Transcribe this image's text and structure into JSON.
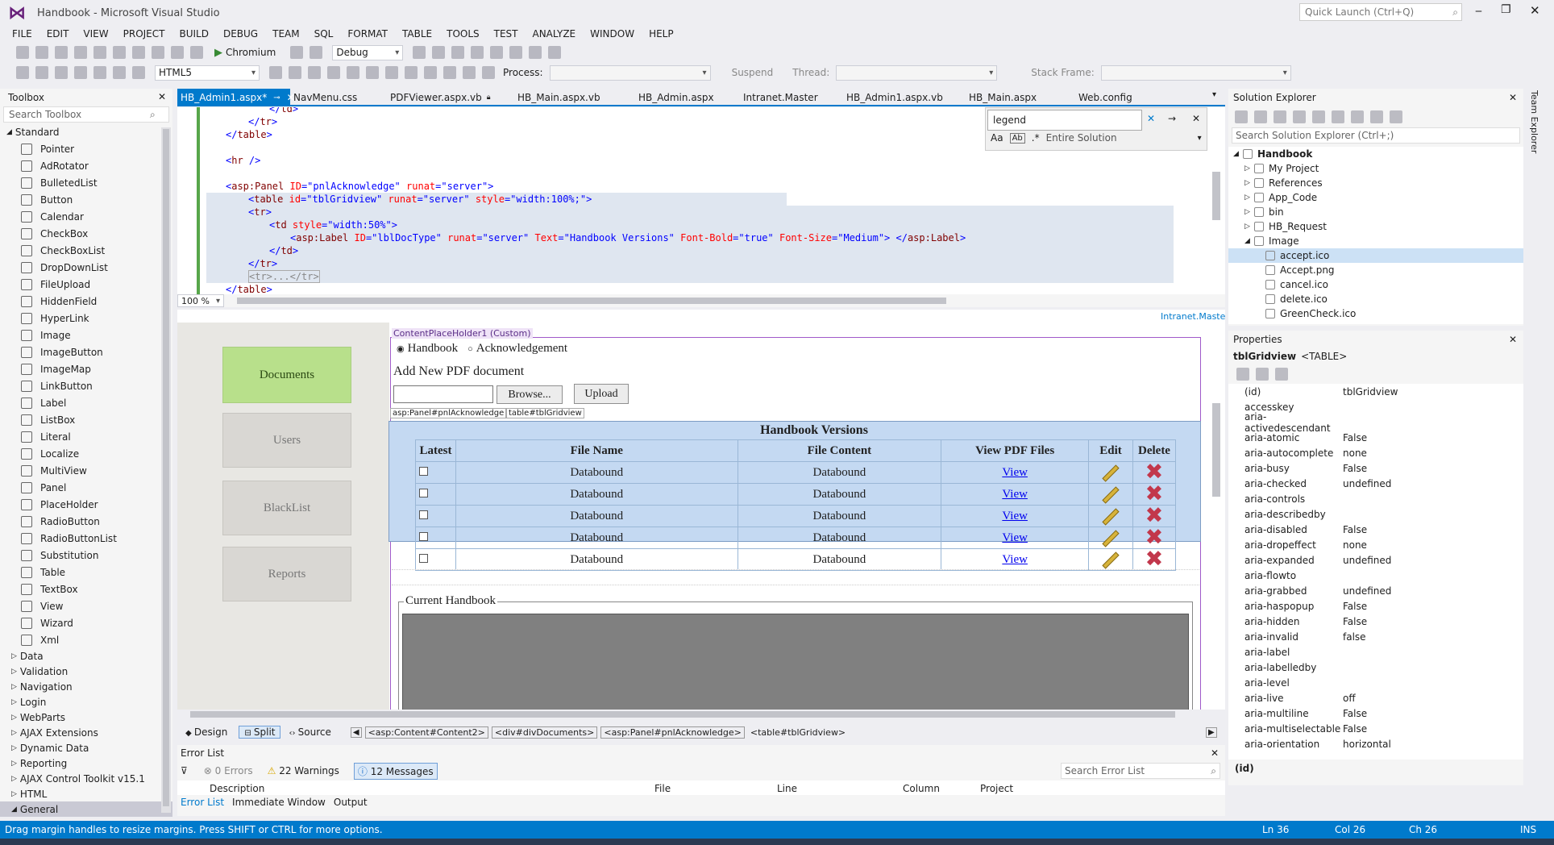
{
  "title": "Handbook - Microsoft Visual Studio",
  "quick_launch": "Quick Launch (Ctrl+Q)",
  "menu": [
    "FILE",
    "EDIT",
    "VIEW",
    "PROJECT",
    "BUILD",
    "DEBUG",
    "TEAM",
    "SQL",
    "FORMAT",
    "TABLE",
    "TOOLS",
    "TEST",
    "ANALYZE",
    "WINDOW",
    "HELP"
  ],
  "toolbar": {
    "browser": "Chromium",
    "config": "Debug",
    "schema": "HTML5",
    "process_label": "Process:",
    "suspend": "Suspend",
    "thread_label": "Thread:",
    "stack_label": "Stack Frame:"
  },
  "toolbox": {
    "title": "Toolbox",
    "search": "Search Toolbox",
    "section": "Standard",
    "items": [
      "Pointer",
      "AdRotator",
      "BulletedList",
      "Button",
      "Calendar",
      "CheckBox",
      "CheckBoxList",
      "DropDownList",
      "FileUpload",
      "HiddenField",
      "HyperLink",
      "Image",
      "ImageButton",
      "ImageMap",
      "LinkButton",
      "Label",
      "ListBox",
      "Literal",
      "Localize",
      "MultiView",
      "Panel",
      "PlaceHolder",
      "RadioButton",
      "RadioButtonList",
      "Substitution",
      "Table",
      "TextBox",
      "View",
      "Wizard",
      "Xml"
    ],
    "groups": [
      "Data",
      "Validation",
      "Navigation",
      "Login",
      "WebParts",
      "AJAX Extensions",
      "Dynamic Data",
      "Reporting",
      "AJAX Control Toolkit v15.1",
      "HTML",
      "General"
    ]
  },
  "tabs": [
    "HB_Admin1.aspx*",
    "NavMenu.css",
    "PDFViewer.aspx.vb",
    "HB_Main.aspx.vb",
    "HB_Admin.aspx",
    "Intranet.Master",
    "HB_Admin1.aspx.vb",
    "HB_Main.aspx",
    "Web.config"
  ],
  "find": {
    "text": "legend",
    "scope": "Entire Solution"
  },
  "code": {
    "zoom": "100 %"
  },
  "master_link": "Intranet.Master",
  "design": {
    "placeholder_label": "ContentPlaceHolder1 (Custom)",
    "nav": [
      "Documents",
      "Users",
      "BlackList",
      "Reports"
    ],
    "radio1": "Handbook",
    "radio2": "Acknowledgement",
    "add_new": "Add New PDF document",
    "browse": "Browse...",
    "upload": "Upload",
    "panel_tag": "asp:Panel#pnlAcknowledge",
    "table_tag": "table#tblGridview",
    "grid_title": "Handbook Versions",
    "headers": [
      "Latest",
      "File Name",
      "File Content",
      "View PDF Files",
      "Edit",
      "Delete"
    ],
    "rows": [
      [
        "Databound",
        "Databound",
        "View"
      ],
      [
        "Databound",
        "Databound",
        "View"
      ],
      [
        "Databound",
        "Databound",
        "View"
      ],
      [
        "Databound",
        "Databound",
        "View"
      ],
      [
        "Databound",
        "Databound",
        "View"
      ]
    ],
    "current": "Current Handbook"
  },
  "bottom_tabs": [
    "Design",
    "Split",
    "Source"
  ],
  "breadcrumbs": [
    "<asp:Content#Content2>",
    "<div#divDocuments>",
    "<asp:Panel#pnlAcknowledge>",
    "<table#tblGridview>"
  ],
  "errors": {
    "title": "Error List",
    "errors": "0 Errors",
    "warnings": "22 Warnings",
    "messages": "12 Messages",
    "search": "Search Error List",
    "cols": [
      "Description",
      "File",
      "Line",
      "Column",
      "Project"
    ],
    "tabs": [
      "Error List",
      "Immediate Window",
      "Output"
    ]
  },
  "solution": {
    "title": "Solution Explorer",
    "search": "Search Solution Explorer (Ctrl+;)",
    "items": [
      "Handbook",
      "My Project",
      "References",
      "App_Code",
      "bin",
      "HB_Request",
      "Image",
      "accept.ico",
      "Accept.png",
      "cancel.ico",
      "delete.ico",
      "GreenCheck.ico"
    ]
  },
  "properties": {
    "title": "Properties",
    "object": "tblGridview",
    "type": "<TABLE>",
    "rows": [
      [
        "(id)",
        "tblGridview"
      ],
      [
        "accesskey",
        ""
      ],
      [
        "aria-activedescendant",
        ""
      ],
      [
        "aria-atomic",
        "False"
      ],
      [
        "aria-autocomplete",
        "none"
      ],
      [
        "aria-busy",
        "False"
      ],
      [
        "aria-checked",
        "undefined"
      ],
      [
        "aria-controls",
        ""
      ],
      [
        "aria-describedby",
        ""
      ],
      [
        "aria-disabled",
        "False"
      ],
      [
        "aria-dropeffect",
        "none"
      ],
      [
        "aria-expanded",
        "undefined"
      ],
      [
        "aria-flowto",
        ""
      ],
      [
        "aria-grabbed",
        "undefined"
      ],
      [
        "aria-haspopup",
        "False"
      ],
      [
        "aria-hidden",
        "False"
      ],
      [
        "aria-invalid",
        "false"
      ],
      [
        "aria-label",
        ""
      ],
      [
        "aria-labelledby",
        ""
      ],
      [
        "aria-level",
        ""
      ],
      [
        "aria-live",
        "off"
      ],
      [
        "aria-multiline",
        "False"
      ],
      [
        "aria-multiselectable",
        "False"
      ],
      [
        "aria-orientation",
        "horizontal"
      ]
    ],
    "footer": "(id)"
  },
  "team_explorer": "Team Explorer",
  "status": {
    "msg": "Drag margin handles to resize margins. Press SHIFT or CTRL for more options.",
    "ln": "Ln 36",
    "col": "Col 26",
    "ch": "Ch 26",
    "ins": "INS"
  }
}
